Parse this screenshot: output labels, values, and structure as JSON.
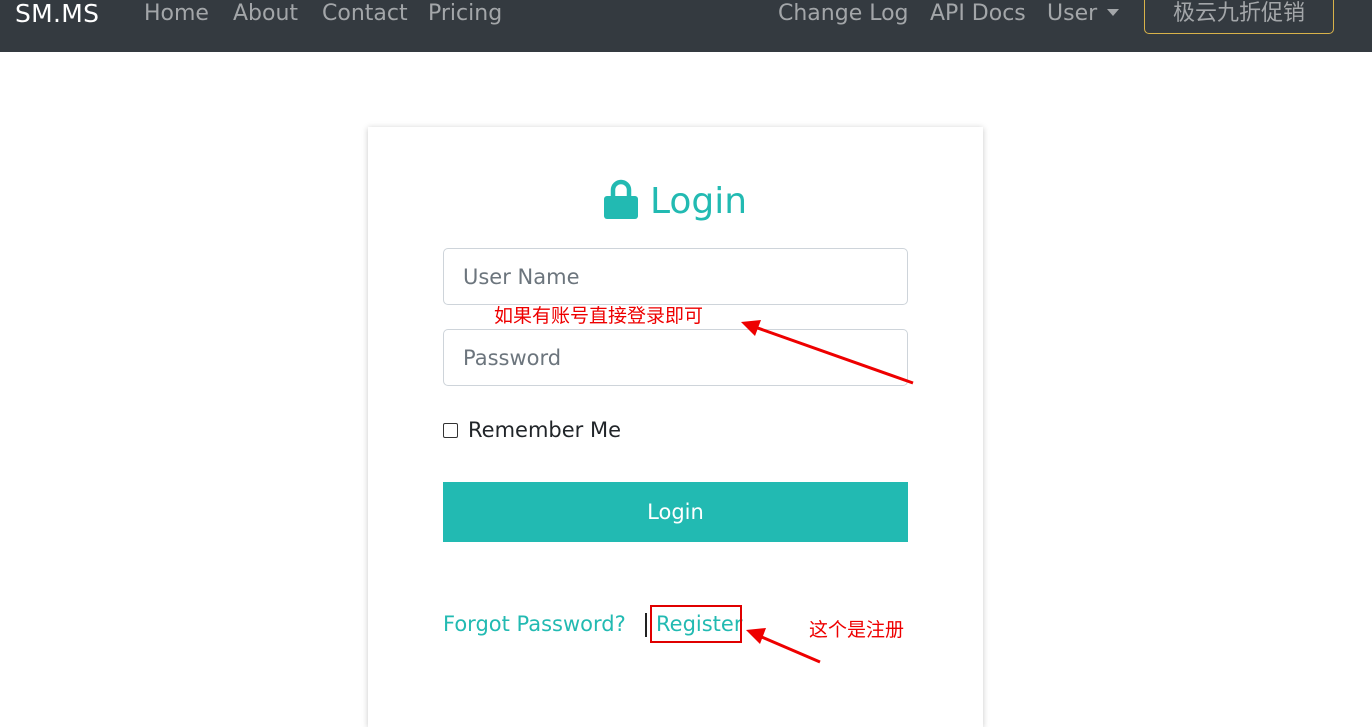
{
  "navbar": {
    "brand": "SM.MS",
    "links": [
      "Home",
      "About",
      "Contact",
      "Pricing"
    ],
    "right_links": [
      "Change Log",
      "API Docs"
    ],
    "user_dropdown": "User",
    "promo_button": "极云九折促销"
  },
  "login_card": {
    "title": "Login",
    "username_placeholder": "User Name",
    "password_placeholder": "Password",
    "remember_label": "Remember Me",
    "login_button": "Login",
    "forgot_link": "Forgot Password?",
    "register_link": "Register"
  },
  "annotations": {
    "login_note": "如果有账号直接登录即可",
    "register_note": "这个是注册"
  },
  "colors": {
    "navbar": "#343a40",
    "accent": "#22bab2",
    "annotation": "#ee0000"
  }
}
